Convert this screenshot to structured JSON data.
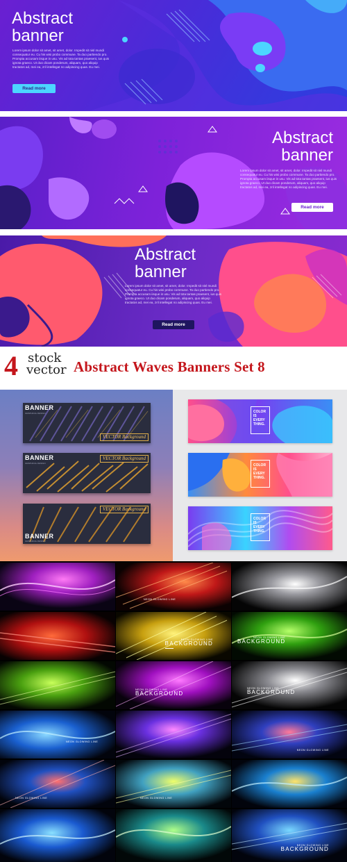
{
  "banners": [
    {
      "title_line1": "Abstract",
      "title_line2": "banner",
      "body": "Lorem ipsum dolor sit amet, sit amet, dolor. Impedit sit nisl mundi consequatur eu. Cu his wisi probo commune. Ta duo partiendo pro. Prompta accusam iisque in usu. Vis ad tota tantas praesent, ius quis ignota graeco. Ut duo dicam ponderum, aliquam, quo aliquip tractatos ad, mei ea, zril intellegat no adipiscing quas. Eu mei.",
      "button": "Read more"
    },
    {
      "title_line1": "Abstract",
      "title_line2": "banner",
      "body": "Lorem ipsum dolor sit amet, sit amet, dolor. Impedit sit nisl mundi consequatur eu. Cu his wisi probo commune. Ta duo partiendo pro. Prompta accusam iisque in usu. Vis ad tota tantas praesent, ius quis ignota graeco. Ut duo dicam ponderum, aliquam, quo aliquip tractatos ad, mei ea, zril intellegat no adipiscing quas. Eu mei.",
      "button": "Read more"
    },
    {
      "title_line1": "Abstract",
      "title_line2": "banner",
      "body": "Lorem ipsum dolor sit amet, sit amet, dolor. Impedit sit nisl mundi consequatur eu. Cu his wisi probo commune. Ta duo partiendo pro. Prompta accusam iisque in usu. Vis ad tota tantas praesent, ius quis ignota graeco. Ut duo dicam ponderum, aliquam, quo aliquip tractatos ad, mei ea, zril intellegat no adipiscing quas. Eu mei.",
      "button": "Read more"
    }
  ],
  "watermark": {
    "number": "4",
    "word1": "stock",
    "word2": "vector",
    "title": "Abstract Waves Banners Set 8"
  },
  "dark_cards": [
    {
      "label": "BANNER",
      "sub": "GRAPHICAL DESIGN",
      "tag": "VECTOR Background"
    },
    {
      "label": "BANNER",
      "sub": "GRAPHICAL DESIGN",
      "tag": "VECTOR Background"
    },
    {
      "label": "BANNER",
      "sub": "GRAPHICAL DESIGN",
      "tag": "VECTOR Background"
    }
  ],
  "fluid_cards": [
    {
      "l1": "COLOR",
      "l2": "IS",
      "l3": "EVERY",
      "l4": "THING."
    },
    {
      "l1": "COLOR",
      "l2": "IS",
      "l3": "EVERY",
      "l4": "THING."
    },
    {
      "l1": "COLOR",
      "l2": "IS",
      "l3": "EVERY",
      "l4": "THING."
    }
  ],
  "neon_caption": {
    "line1": "NEON GLOWING LINE",
    "line2": "BACKGROUND"
  },
  "colors": {
    "accent_red": "#c4161c",
    "violet": "#6a1fd1",
    "cyan": "#3ad3ff",
    "pink": "#ff5a8c"
  }
}
